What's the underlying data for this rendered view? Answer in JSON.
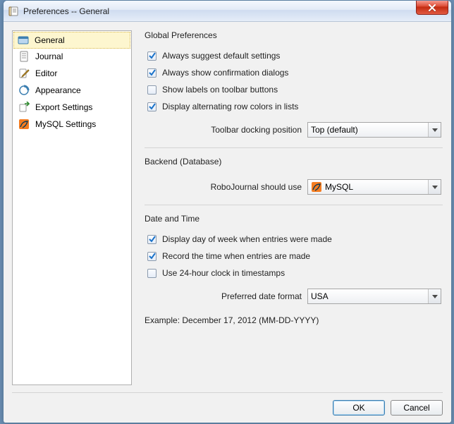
{
  "window": {
    "title": "Preferences -- General"
  },
  "nav": {
    "items": [
      {
        "label": "General",
        "icon": "general",
        "selected": true
      },
      {
        "label": "Journal",
        "icon": "journal",
        "selected": false
      },
      {
        "label": "Editor",
        "icon": "editor",
        "selected": false
      },
      {
        "label": "Appearance",
        "icon": "appearance",
        "selected": false
      },
      {
        "label": "Export Settings",
        "icon": "export",
        "selected": false
      },
      {
        "label": "MySQL Settings",
        "icon": "mysql",
        "selected": false
      }
    ]
  },
  "sections": {
    "global": {
      "title": "Global Preferences",
      "checks": [
        {
          "label": "Always suggest default settings",
          "checked": true
        },
        {
          "label": "Always show confirmation dialogs",
          "checked": true
        },
        {
          "label": "Show labels on toolbar buttons",
          "checked": false
        },
        {
          "label": "Display alternating row colors in lists",
          "checked": true
        }
      ],
      "docking": {
        "label": "Toolbar docking position",
        "value": "Top (default)"
      }
    },
    "backend": {
      "title": "Backend (Database)",
      "use": {
        "label": "RoboJournal should use",
        "value": "MySQL"
      }
    },
    "datetime": {
      "title": "Date and Time",
      "checks": [
        {
          "label": "Display day of week when entries were made",
          "checked": true
        },
        {
          "label": "Record the time when entries are made",
          "checked": true
        },
        {
          "label": "Use 24-hour clock in timestamps",
          "checked": false
        }
      ],
      "format": {
        "label": "Preferred date format",
        "value": "USA"
      },
      "example": "Example: December 17, 2012 (MM-DD-YYYY)"
    }
  },
  "footer": {
    "ok": "OK",
    "cancel": "Cancel"
  }
}
